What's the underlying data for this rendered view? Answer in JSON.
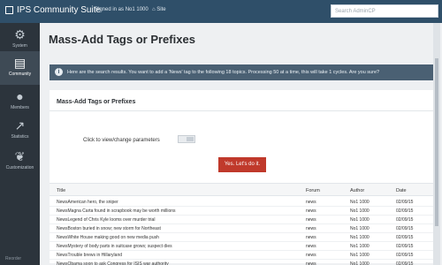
{
  "app": {
    "title": "IPS Community Suite"
  },
  "topbar": {
    "signed_in": "Signed in as No1 1000",
    "site": "Site",
    "search_placeholder": "Search AdminCP"
  },
  "sidebar": {
    "items": [
      {
        "label": "System",
        "icon": "gears-icon"
      },
      {
        "label": "Community",
        "icon": "document-icon"
      },
      {
        "label": "Members",
        "icon": "user-icon"
      },
      {
        "label": "Statistics",
        "icon": "chart-icon"
      },
      {
        "label": "Customization",
        "icon": "leaf-icon"
      }
    ],
    "bottom": "Reorder"
  },
  "page": {
    "title": "Mass-Add Tags or Prefixes"
  },
  "info_message": "Here are the search results. You want to add a 'News' tag to the following 18 topics. Processing 50 at a time, this will take 1 cycles. Are you sure?",
  "panel": {
    "heading": "Mass-Add Tags or Prefixes",
    "param_label": "Click to view/change parameters",
    "confirm_button": "Yes. Let's do it."
  },
  "table": {
    "headers": [
      "Title",
      "Forum",
      "Author",
      "Date"
    ],
    "rows": [
      [
        "NewsAmerican hero, the sniper",
        "news",
        "No1 1000",
        "02/09/15"
      ],
      [
        "NewsMagna Carta found in scrapbook may be worth millions",
        "news",
        "No1 1000",
        "02/09/15"
      ],
      [
        "NewsLegend of Chris Kyle looms over murder trial",
        "news",
        "No1 1000",
        "02/09/15"
      ],
      [
        "NewsBoston buried in snow; new storm for Northeast",
        "news",
        "No1 1000",
        "02/09/15"
      ],
      [
        "NewsWhite House making good on new media push",
        "news",
        "No1 1000",
        "02/09/15"
      ],
      [
        "NewsMystery of body parts in suitcase grows; suspect dies",
        "news",
        "No1 1000",
        "02/09/15"
      ],
      [
        "NewsTrouble brews in Hillaryland",
        "news",
        "No1 1000",
        "02/09/15"
      ],
      [
        "NewsObama soon to ask Congress for ISIS war authority",
        "news",
        "No1 1000",
        "02/09/15"
      ]
    ]
  },
  "colors": {
    "topbar": "#2f4f69",
    "sidebar": "#2c343c",
    "info": "#4a6073",
    "danger": "#c0392b"
  }
}
